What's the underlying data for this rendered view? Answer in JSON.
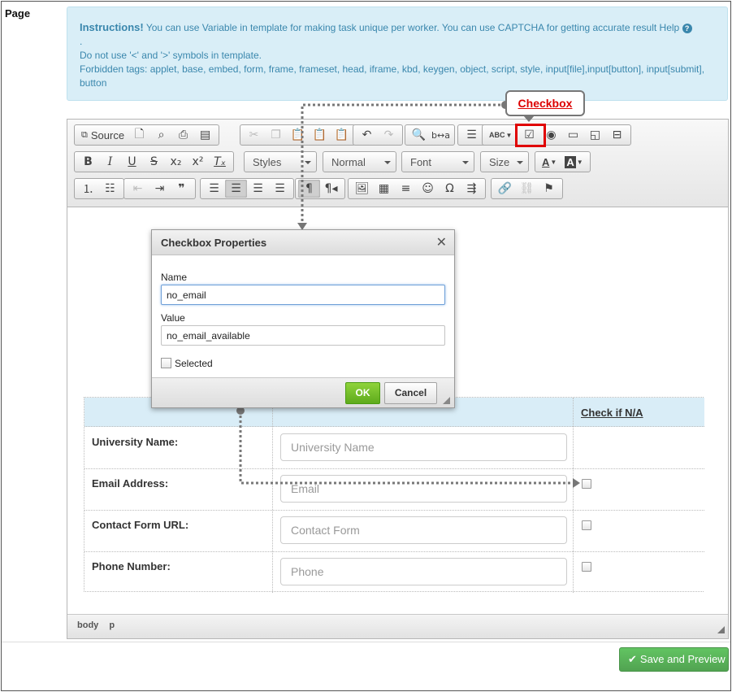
{
  "page": {
    "label": "Page"
  },
  "instructions": {
    "heading": "Instructions!",
    "line1": "You can use Variable in template for making task unique per worker. You can use CAPTCHA for getting accurate result Help",
    "help_icon": "question-circle-icon",
    "dot": ".",
    "line2": "Do not use '<' and '>' symbols in template.",
    "line3": "Forbidden tags: applet, base, embed, form, frame, frameset, head, iframe, kbd, keygen, object, script, style, input[file],input[button], input[submit], button"
  },
  "toolbar": {
    "source_label": "Source",
    "styles_label": "Styles",
    "format_label": "Normal",
    "font_label": "Font",
    "size_label": "Size",
    "bold": "B",
    "italic": "I",
    "underline": "U",
    "strike": "S",
    "text_color": "A",
    "bg_color": "A",
    "spell_check": "ABC"
  },
  "callout": {
    "label": "Checkbox"
  },
  "dialog": {
    "title": "Checkbox Properties",
    "name_label": "Name",
    "name_value": "no_email",
    "value_label": "Value",
    "value_value": "no_email_available",
    "selected_label": "Selected",
    "ok_label": "OK",
    "cancel_label": "Cancel"
  },
  "form_table": {
    "header_na": "Check if N/A",
    "rows": [
      {
        "label": "University Name:",
        "placeholder": "University Name",
        "has_checkbox": false
      },
      {
        "label": "Email Address:",
        "placeholder": "Email",
        "has_checkbox": true
      },
      {
        "label": "Contact Form URL:",
        "placeholder": "Contact Form",
        "has_checkbox": true
      },
      {
        "label": "Phone Number:",
        "placeholder": "Phone",
        "has_checkbox": true
      }
    ]
  },
  "statusbar": {
    "path": [
      "body",
      "p"
    ]
  },
  "actions": {
    "save_preview_label": "Save and Preview"
  },
  "colors": {
    "accent_red": "#e00000",
    "ok_green": "#5eab1c",
    "save_green": "#51a351",
    "info_blue": "#3a87ad"
  }
}
